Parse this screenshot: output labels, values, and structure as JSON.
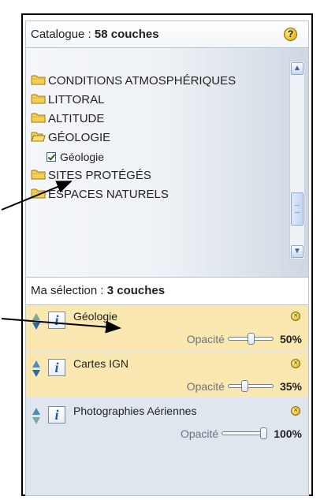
{
  "catalogue": {
    "label": "Catalogue : ",
    "count": "58 couches",
    "help": "?"
  },
  "tree": {
    "nodes": [
      {
        "label": "CONDITIONS ATMOSPHÉRIQUES",
        "icon": "folder-icon"
      },
      {
        "label": "LITTORAL",
        "icon": "folder-icon"
      },
      {
        "label": "ALTITUDE",
        "icon": "folder-icon"
      },
      {
        "label": "GÉOLOGIE",
        "icon": "open-folder-icon"
      },
      {
        "label": "Géologie",
        "icon": "checkbox-checked",
        "checked": true
      },
      {
        "label": "SITES PROTÉGÉS",
        "icon": "folder-icon"
      },
      {
        "label": "ESPACES NATURELS",
        "icon": "folder-icon"
      }
    ],
    "scroll_up": "▲",
    "scroll_down": "▼"
  },
  "selection": {
    "label": "Ma sélection : ",
    "count": "3 couches",
    "layers": [
      {
        "name": "Géologie",
        "opacity_label": "Opacité",
        "opacity": "50%",
        "opacity_value": 0.5,
        "active": true
      },
      {
        "name": "Cartes IGN",
        "opacity_label": "Opacité",
        "opacity": "35%",
        "opacity_value": 0.35,
        "active": true
      },
      {
        "name": "Photographies Aériennes",
        "opacity_label": "Opacité",
        "opacity": "100%",
        "opacity_value": 1.0,
        "active": false
      }
    ],
    "info_glyph": "i",
    "remove_glyph": "×"
  },
  "colors": {
    "active_layer_bg": "#fbe7b0",
    "panel_bg": "#dfe6ee",
    "arrow_blue": "#2b6aa8"
  }
}
